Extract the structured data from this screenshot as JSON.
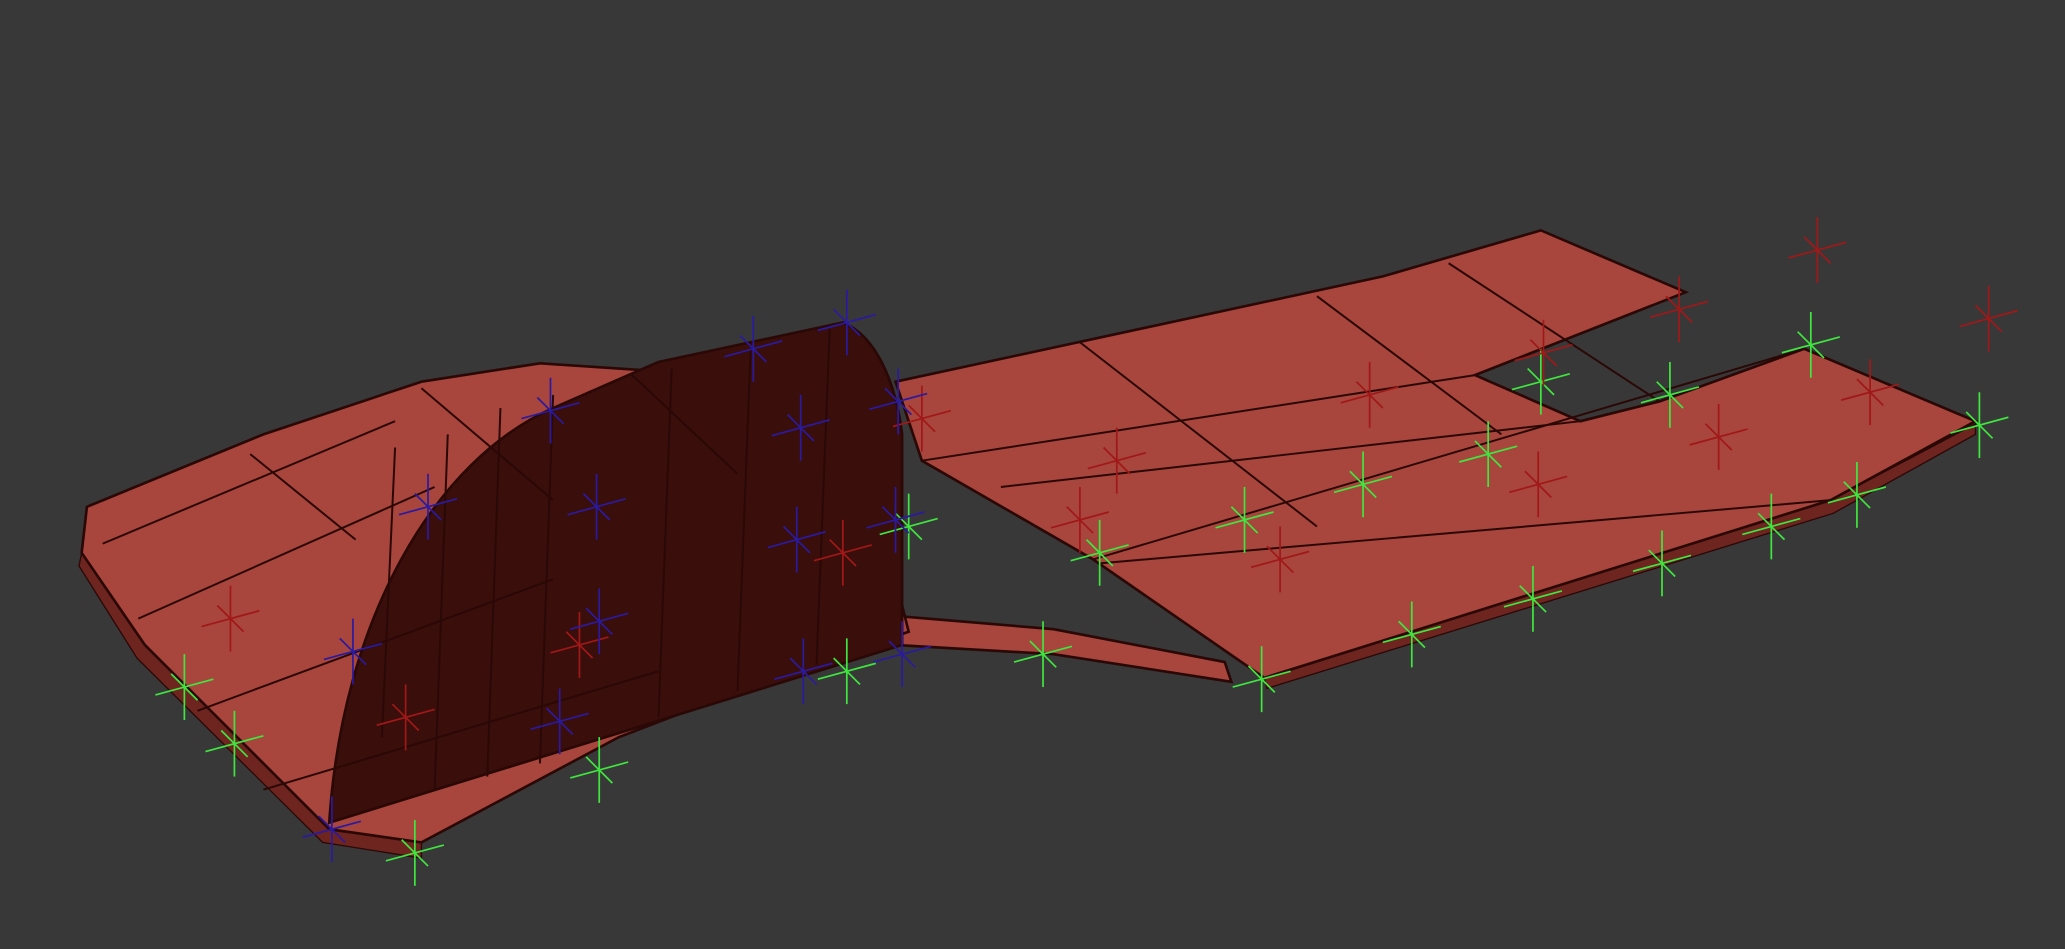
{
  "viewport": {
    "background_color": "#383838",
    "mesh_color": "#a8453c",
    "mesh_side_color": "#6e2520",
    "wall_color": "#3a0e0b",
    "wire_color": "#2a0806",
    "helper_colors": {
      "green": "#3fe63f",
      "red": "#a01818",
      "blue": "#2a1aa0"
    }
  }
}
